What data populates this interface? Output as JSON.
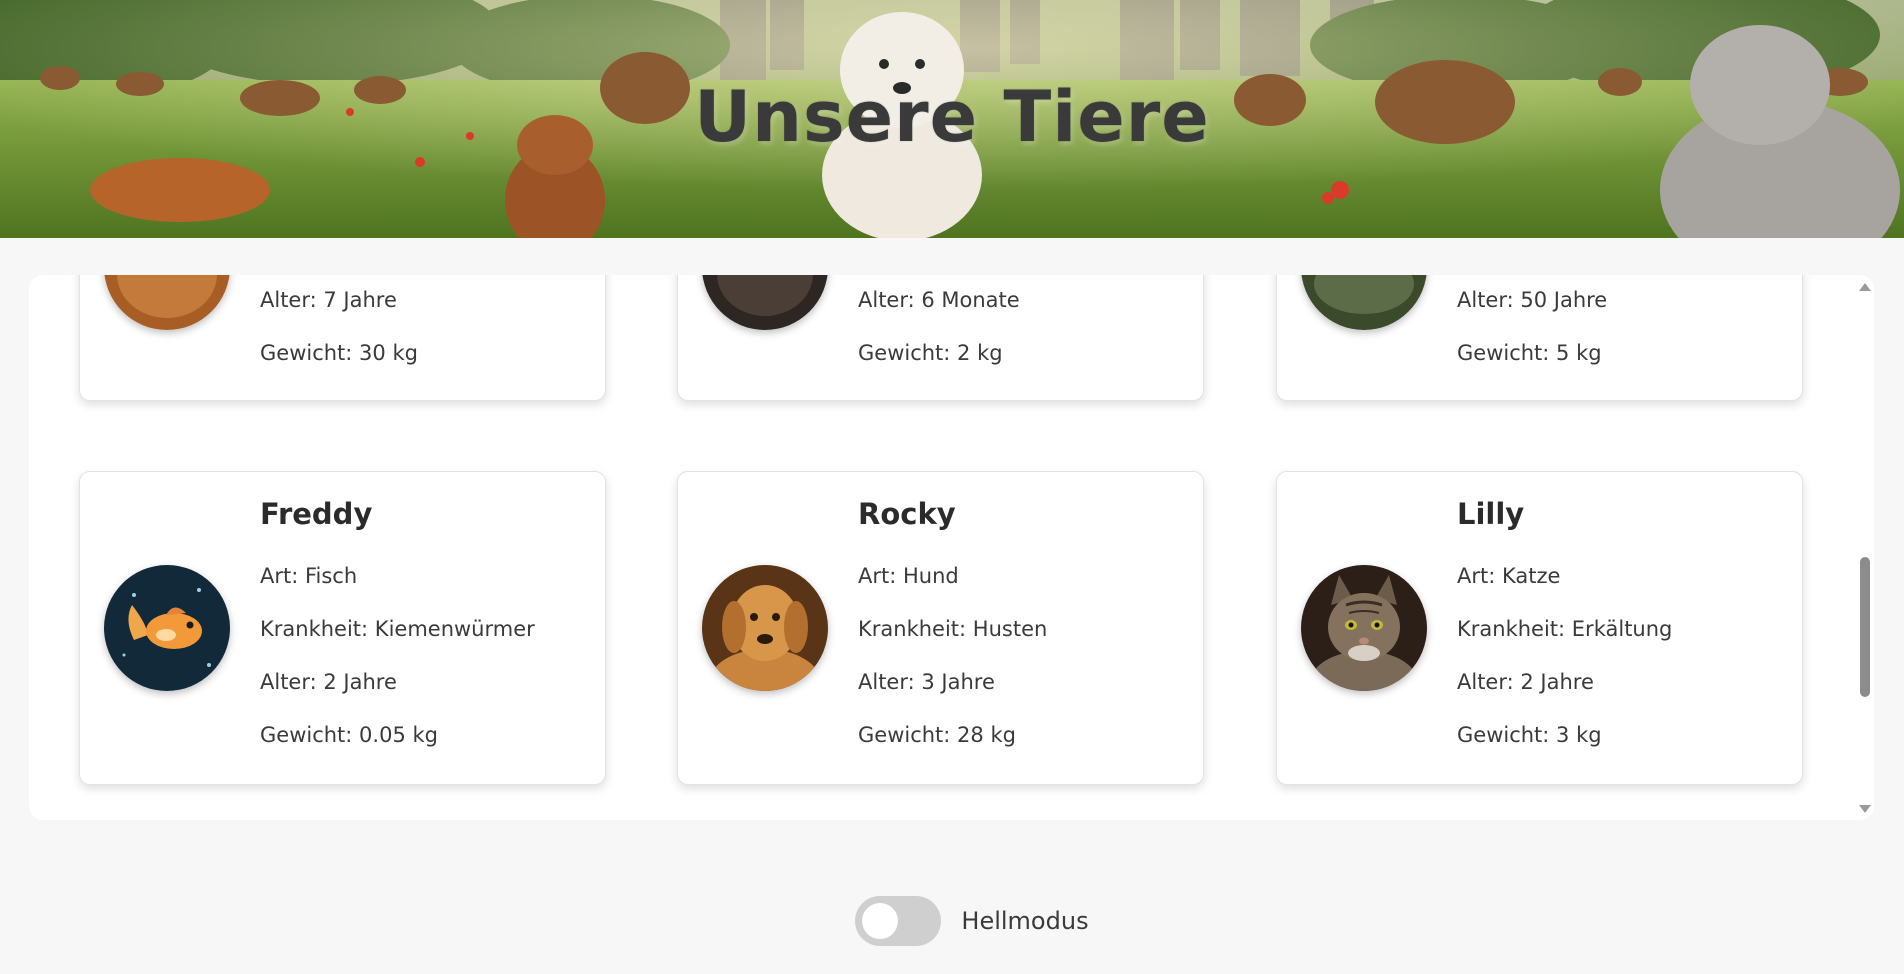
{
  "header": {
    "title": "Unsere Tiere"
  },
  "pets_partial": [
    {
      "age": "Alter: 7 Jahre",
      "weight": "Gewicht: 30 kg"
    },
    {
      "age": "Alter: 6 Monate",
      "weight": "Gewicht: 2 kg"
    },
    {
      "age": "Alter: 50 Jahre",
      "weight": "Gewicht: 5 kg"
    }
  ],
  "pets": [
    {
      "name": "Freddy",
      "species": "Art: Fisch",
      "illness": "Krankheit: Kiemenwürmer",
      "age": "Alter: 2 Jahre",
      "weight": "Gewicht: 0.05 kg",
      "photo": "goldfish-photo"
    },
    {
      "name": "Rocky",
      "species": "Art: Hund",
      "illness": "Krankheit: Husten",
      "age": "Alter: 3 Jahre",
      "weight": "Gewicht: 28 kg",
      "photo": "golden-retriever-photo"
    },
    {
      "name": "Lilly",
      "species": "Art: Katze",
      "illness": "Krankheit: Erkältung",
      "age": "Alter: 2 Jahre",
      "weight": "Gewicht: 3 kg",
      "photo": "tabby-cat-photo"
    }
  ],
  "theme_toggle": {
    "label": "Hellmodus",
    "checked": false
  },
  "colors": {
    "page_background": "#f7f7f7",
    "card_background": "#ffffff",
    "toggle_track": "#cfcfcf"
  }
}
